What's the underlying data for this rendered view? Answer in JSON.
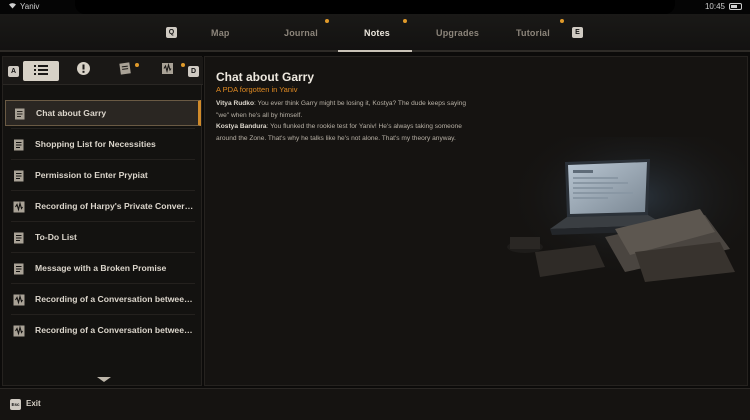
{
  "status_bar": {
    "carrier": "Yaniv",
    "time": "10:45"
  },
  "nav": {
    "left_key": "Q",
    "right_key": "E",
    "tabs": [
      {
        "label": "Map",
        "active": false,
        "dot": false
      },
      {
        "label": "Journal",
        "active": false,
        "dot": true
      },
      {
        "label": "Notes",
        "active": true,
        "dot": true
      },
      {
        "label": "Upgrades",
        "active": false,
        "dot": false
      },
      {
        "label": "Tutorial",
        "active": false,
        "dot": true
      }
    ]
  },
  "filters": {
    "left_key": "A",
    "right_key": "D",
    "buttons": [
      {
        "icon": "list-icon",
        "active": true,
        "dot": false
      },
      {
        "icon": "alert-icon",
        "active": false,
        "dot": false
      },
      {
        "icon": "document-icon",
        "active": false,
        "dot": true
      },
      {
        "icon": "audio-recording-icon",
        "active": false,
        "dot": true
      }
    ]
  },
  "notes": [
    {
      "label": "Chat about Garry",
      "icon": "document-icon",
      "selected": true
    },
    {
      "label": "Shopping List for Necessities",
      "icon": "document-icon",
      "selected": false
    },
    {
      "label": "Permission to Enter Prypiat",
      "icon": "document-icon",
      "selected": false
    },
    {
      "label": "Recording of Harpy's Private Conversation...",
      "icon": "audio-recording-icon",
      "selected": false
    },
    {
      "label": "To-Do List",
      "icon": "document-icon",
      "selected": false
    },
    {
      "label": "Message with a Broken Promise",
      "icon": "document-icon",
      "selected": false
    },
    {
      "label": "Recording of a Conversation between Faust...",
      "icon": "audio-recording-icon",
      "selected": false
    },
    {
      "label": "Recording of a Conversation between Faust...",
      "icon": "audio-recording-icon",
      "selected": false
    }
  ],
  "detail": {
    "title": "Chat about Garry",
    "subtitle": "A PDA forgotten in Yaniv",
    "lines": [
      {
        "speaker": "Vitya Rudko",
        "text": ": You ever think Garry might be losing it, Kostya? The dude keeps saying \"we\" when he's all by himself."
      },
      {
        "speaker": "Kostya Bandura",
        "text": ": You flunked the rookie test for Yaniv! He's always taking someone around the Zone. That's why he talks like he's not alone. That's my theory anyway."
      }
    ]
  },
  "footer": {
    "key": "Esc",
    "exit_label": "Exit"
  },
  "colors": {
    "accent": "#e09a2a",
    "background": "#0c0b0a",
    "panel": "#151311"
  }
}
